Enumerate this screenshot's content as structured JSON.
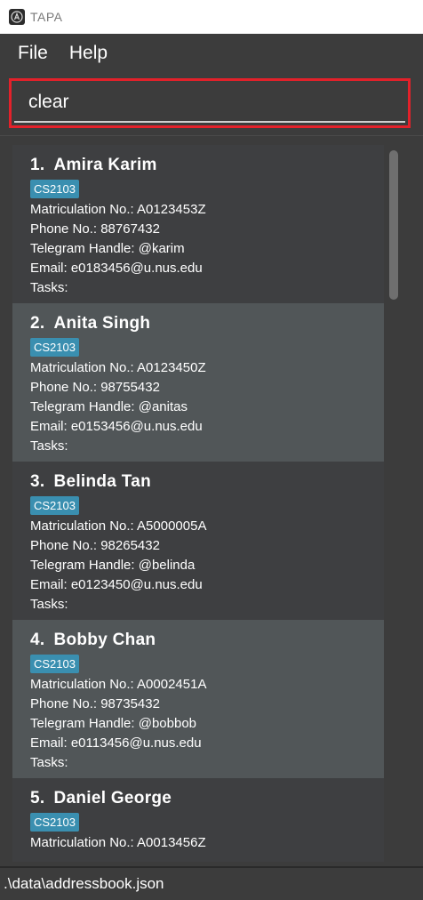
{
  "window": {
    "title": "TAPA",
    "icon": "app-icon"
  },
  "menu": {
    "file": "File",
    "help": "Help"
  },
  "command": {
    "value": "clear",
    "border_color": "#e3212a"
  },
  "persons": [
    {
      "index": "1.",
      "name": "Amira Karim",
      "tag": "CS2103",
      "matric": "Matriculation No.: A0123453Z",
      "phone": "Phone No.: 88767432",
      "telegram": "Telegram Handle: @karim",
      "email": "Email: e0183456@u.nus.edu",
      "tasks": "Tasks:"
    },
    {
      "index": "2.",
      "name": "Anita Singh",
      "tag": "CS2103",
      "matric": "Matriculation No.: A0123450Z",
      "phone": "Phone No.: 98755432",
      "telegram": "Telegram Handle: @anitas",
      "email": "Email: e0153456@u.nus.edu",
      "tasks": "Tasks:"
    },
    {
      "index": "3.",
      "name": "Belinda Tan",
      "tag": "CS2103",
      "matric": "Matriculation No.: A5000005A",
      "phone": "Phone No.: 98265432",
      "telegram": "Telegram Handle: @belinda",
      "email": "Email: e0123450@u.nus.edu",
      "tasks": "Tasks:"
    },
    {
      "index": "4.",
      "name": "Bobby Chan",
      "tag": "CS2103",
      "matric": "Matriculation No.: A0002451A",
      "phone": "Phone No.: 98735432",
      "telegram": "Telegram Handle: @bobbob",
      "email": "Email: e0113456@u.nus.edu",
      "tasks": "Tasks:"
    },
    {
      "index": "5.",
      "name": "Daniel George",
      "tag": "CS2103",
      "matric": "Matriculation No.: A0013456Z"
    }
  ],
  "status": {
    "path": ".\\data\\addressbook.json"
  },
  "colors": {
    "tag": "#3a8fb0",
    "card_odd": "#3e3f41",
    "card_even": "#515658",
    "background": "#3c3c3c"
  }
}
